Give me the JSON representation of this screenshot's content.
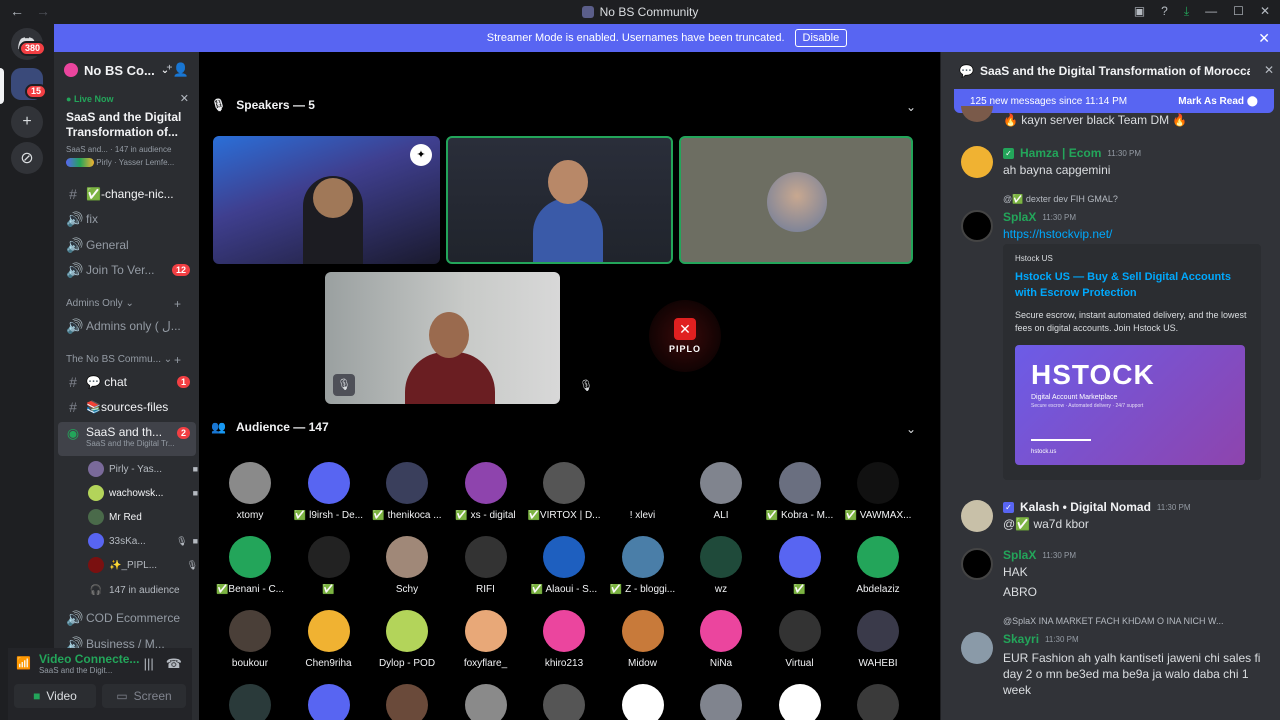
{
  "window": {
    "title": "No BS Community"
  },
  "guilds": {
    "home_badge": "380",
    "server_badge": "15"
  },
  "banner": {
    "text": "Streamer Mode is enabled. Usernames have been truncated.",
    "disable_label": "Disable"
  },
  "server": {
    "name": "No BS Co...",
    "live_label": "Live Now",
    "live_title": "SaaS and the Digital Transformation of...",
    "live_meta": "SaaS and... · 147 in audience",
    "live_users": "Pirly · Yasser Lemfe..."
  },
  "channels": [
    {
      "name": "✅-change-nic...",
      "icon": "#"
    },
    {
      "name": "fix",
      "icon": "🔊"
    },
    {
      "name": "General",
      "icon": "🔊"
    },
    {
      "name": "Join To Ver...",
      "icon": "🔊",
      "badge": "12"
    },
    {
      "category": "Admins Only"
    },
    {
      "name": "Admins only ( ل...",
      "icon": "🔊"
    },
    {
      "category": "The No BS Commu..."
    },
    {
      "name": "💬 chat",
      "icon": "#",
      "badge": "1"
    },
    {
      "name": "📚sources-files",
      "icon": "#"
    },
    {
      "name": "SaaS and th...",
      "sub": "SaaS and the Digital Tr...",
      "badge": "2"
    },
    {
      "name": "COD Ecommerce",
      "icon": "🔊"
    },
    {
      "name": "Business / M...",
      "icon": "🔊"
    }
  ],
  "voice_users": [
    "Pirly - Yas...",
    "wachowsk...",
    "Mr Red",
    "33sKa...",
    "✨_PIPL...",
    "147 in audience"
  ],
  "voice_bar": {
    "status": "Video Connecte...",
    "channel": "SaaS and the Digit...",
    "video_label": "Video",
    "screen_label": "Screen"
  },
  "stage": {
    "speakers_label": "Speakers — 5",
    "audience_label": "Audience — 147",
    "piplo_label": "PIPLO"
  },
  "audience": [
    {
      "name": "xtomy",
      "color": "#8a8a8a"
    },
    {
      "name": "✅ l9irsh - De...",
      "color": "#5865f2"
    },
    {
      "name": "✅ thenikoca ...",
      "color": "#3a3f5c"
    },
    {
      "name": "✅ xs - digital",
      "color": "#8e44ad"
    },
    {
      "name": "✅VIRTOX | D...",
      "color": "#555"
    },
    {
      "name": "! xlevi",
      "color": "#000"
    },
    {
      "name": "ALI",
      "color": "#80848e"
    },
    {
      "name": "✅ Kobra - M...",
      "color": "#6a6f80"
    },
    {
      "name": "✅ VAWMAX...",
      "color": "#111"
    },
    {
      "name": "✅Benani - C...",
      "color": "#23a55a"
    },
    {
      "name": "✅",
      "color": "#222"
    },
    {
      "name": "Schy",
      "color": "#a08878"
    },
    {
      "name": "RIFI",
      "color": "#333"
    },
    {
      "name": "✅ Alaoui - S...",
      "color": "#1e5fbf"
    },
    {
      "name": "✅ Z - bloggi...",
      "color": "#4a7ea8"
    },
    {
      "name": "wz",
      "color": "#1f4a3a"
    },
    {
      "name": "✅",
      "color": "#5865f2"
    },
    {
      "name": "Abdelaziz",
      "color": "#23a55a"
    },
    {
      "name": "boukour",
      "color": "#4a3f38"
    },
    {
      "name": "Chen9riha",
      "color": "#f0b232"
    },
    {
      "name": "Dylop - POD",
      "color": "#b3d45a"
    },
    {
      "name": "foxyflare_",
      "color": "#e8a878"
    },
    {
      "name": "khiro213",
      "color": "#eb459e"
    },
    {
      "name": "Midow",
      "color": "#c87a3a"
    },
    {
      "name": "NiNa",
      "color": "#eb459e"
    },
    {
      "name": "Virtual",
      "color": "#333"
    },
    {
      "name": "WAHEBI",
      "color": "#3a3a4a"
    }
  ],
  "chat": {
    "title": "SaaS and the Digital Transformation of Moroccan In",
    "new_messages": "125 new messages since 11:14 PM",
    "mark_read": "Mark As Read",
    "messages": [
      {
        "text": "🔥 kayn server black Team DM 🔥"
      },
      {
        "author": "Hamza | Ecom",
        "time": "11:30 PM",
        "text": "ah bayna capgemini",
        "color": "#23a55a"
      },
      {
        "reply": "@✅ dexter dev FIH GMAL?",
        "author": "SplaX",
        "time": "11:30 PM",
        "text": "https://hstockvip.net/",
        "color": "#23a55a"
      },
      {
        "author": "Kalash • Digital Nomad",
        "time": "11:30 PM",
        "text": "@✅ wa7d kbor",
        "color": "#f2f3f5"
      },
      {
        "author": "SplaX",
        "time": "11:30 PM",
        "text": "HAK",
        "text2": "ABRO",
        "color": "#23a55a"
      },
      {
        "reply": "@SplaX INA MARKET FACH KHDAM O INA NICH W...",
        "author": "Skayri",
        "time": "11:30 PM",
        "text": "EUR Fashion ah yalh kantiseti jaweni chi sales fi day 2 o mn be3ed ma be9a ja walo daba chi 1 week",
        "color": "#23a55a"
      }
    ],
    "embed": {
      "provider": "Hstock US",
      "title": "Hstock US — Buy & Sell Digital Accounts with Escrow Protection",
      "description": "Secure escrow, instant automated delivery, and the lowest fees on digital accounts. Join Hstock US.",
      "img_title": "HSTOCK",
      "img_sub": "Digital Account Marketplace",
      "img_sub2": "Secure escrow · Automated delivery · 24/7 support",
      "img_url": "hstock.us"
    }
  }
}
